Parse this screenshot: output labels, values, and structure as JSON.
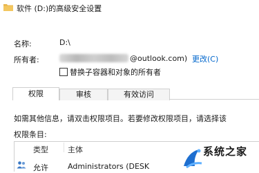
{
  "window": {
    "title": "软件 (D:)的高级安全设置",
    "folder_icon": "folder-icon"
  },
  "props": {
    "name_label": "名称:",
    "name_value": "D:\\",
    "owner_label": "所有者:",
    "owner_email_suffix": "@outlook.com)",
    "change_link": "更改(C)",
    "replace_owner_checkbox": "替换子容器和对象的所有者"
  },
  "tabs": [
    {
      "label": "权限",
      "active": true
    },
    {
      "label": "审核",
      "active": false
    },
    {
      "label": "有效访问",
      "active": false
    }
  ],
  "hint_text": "如需其他信息，请双击权限项目。若要修改权限项目，请选择该",
  "list": {
    "label": "权限条目:",
    "columns": [
      "类型",
      "主体"
    ],
    "rows": [
      {
        "type": "允许",
        "principal": "Administrators (DESK"
      }
    ]
  },
  "watermark": {
    "text": "系统之家"
  },
  "colors": {
    "link": "#0066cc",
    "folder": "#e8b64c"
  }
}
